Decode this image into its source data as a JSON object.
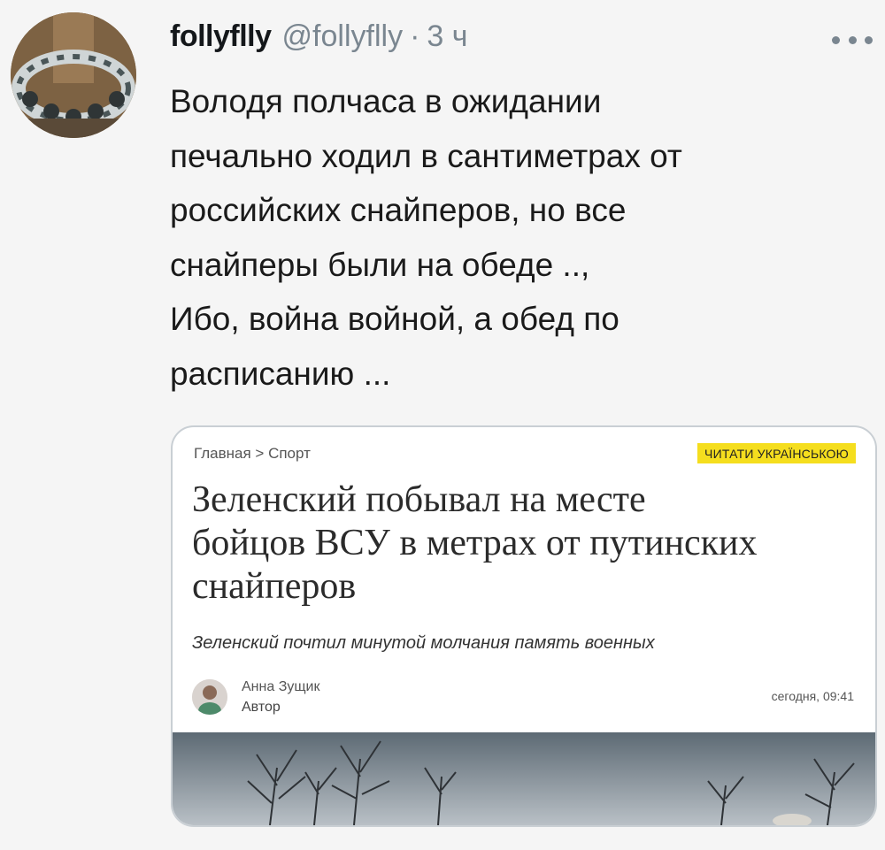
{
  "tweet": {
    "display_name": "follyflly",
    "handle": "@follyflly",
    "separator": "·",
    "time": "3 ч",
    "more_icon": "more-dots-icon",
    "text_lines": [
      "Володя полчаса в ожидании",
      "печально ходил в сантиметрах от",
      "российских снайперов, но все",
      "снайперы были на обеде ..,",
      "Ибо, война войной, а обед по",
      "расписанию ..."
    ]
  },
  "card": {
    "breadcrumb": "Главная > Спорт",
    "language_badge": "ЧИТАТИ УКРАЇНСЬКОЮ",
    "headline_lines": [
      "Зеленский побывал на месте",
      "бойцов ВСУ в метрах от путинских",
      "снайперов"
    ],
    "subheadline": "Зеленский почтил минутой молчания память военных",
    "author": {
      "name": "Анна Зущик",
      "role": "Автор"
    },
    "date": "сегодня, 09:41"
  },
  "colors": {
    "background": "#f5f5f5",
    "muted_text": "#7a8690",
    "badge": "#f5de1e",
    "card_border": "#c9cfd4"
  }
}
